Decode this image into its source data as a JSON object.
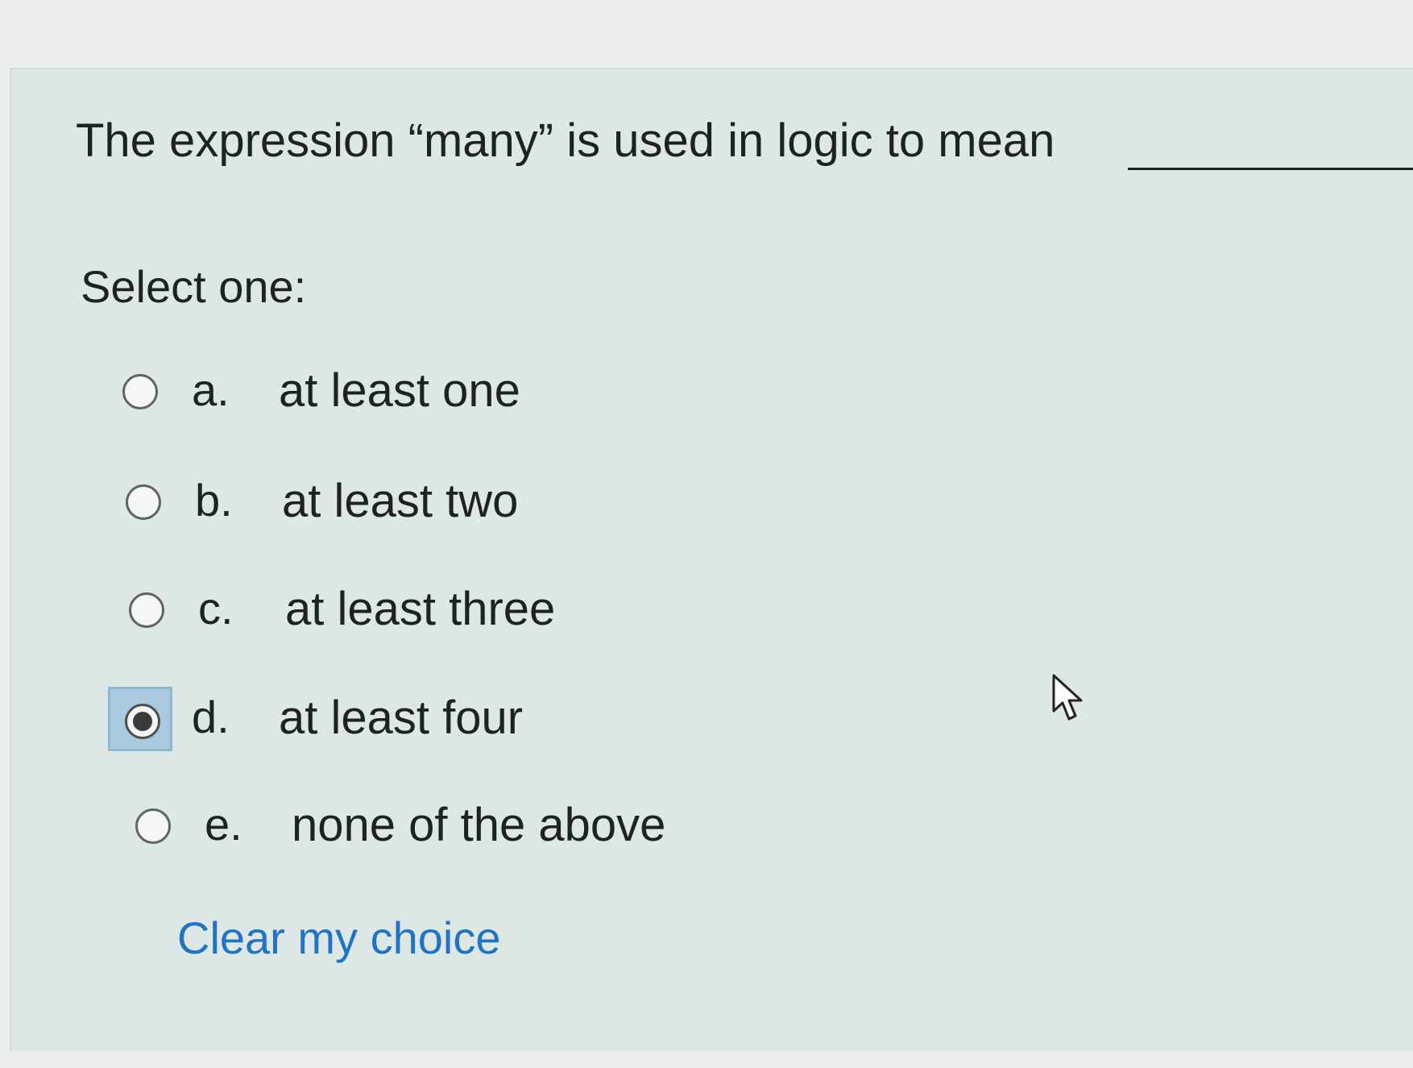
{
  "question": {
    "text": "The expression “many” is used in logic to mean"
  },
  "prompt": "Select one:",
  "options": [
    {
      "letter": "a.",
      "text": "at least one",
      "checked": false
    },
    {
      "letter": "b.",
      "text": "at least two",
      "checked": false
    },
    {
      "letter": "c.",
      "text": "at least three",
      "checked": false
    },
    {
      "letter": "d.",
      "text": "at least four",
      "checked": true
    },
    {
      "letter": "e.",
      "text": "none of the above",
      "checked": false
    }
  ],
  "clear_link": "Clear my choice",
  "colors": {
    "panel_background": "#dde8e6",
    "link": "#1f74c8",
    "focus_highlight": "#a9c9de"
  },
  "icons": {
    "cursor": "pointer-arrow-icon"
  }
}
